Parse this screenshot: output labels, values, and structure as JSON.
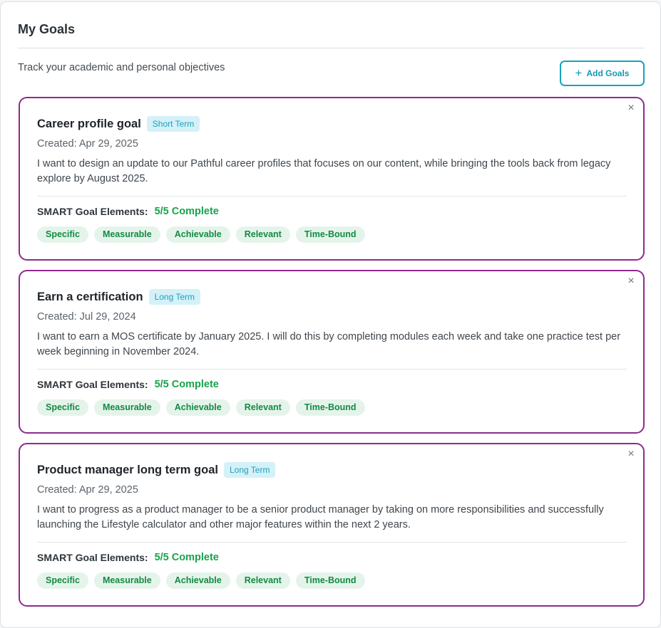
{
  "header": {
    "title": "My Goals",
    "subtitle": "Track your academic and personal objectives",
    "add_button": {
      "icon": "plus-icon",
      "label": "Add Goals"
    }
  },
  "smart_label": "SMART Goal Elements:",
  "goals": [
    {
      "title": "Career profile goal",
      "term": "Short Term",
      "created": "Created: Apr 29, 2025",
      "description": "I want to design an update to our Pathful career profiles that focuses on our content, while bringing the tools back from legacy explore by August 2025.",
      "smart_status": "5/5 Complete",
      "elements": [
        "Specific",
        "Measurable",
        "Achievable",
        "Relevant",
        "Time-Bound"
      ]
    },
    {
      "title": "Earn a certification",
      "term": "Long Term",
      "created": "Created: Jul 29, 2024",
      "description": "I want to earn a MOS certificate by January 2025. I will do this by completing modules each week and take one practice test per week beginning in November 2024.",
      "smart_status": "5/5 Complete",
      "elements": [
        "Specific",
        "Measurable",
        "Achievable",
        "Relevant",
        "Time-Bound"
      ]
    },
    {
      "title": "Product manager long term goal",
      "term": "Long Term",
      "created": "Created: Apr 29, 2025",
      "description": "I want to progress as a product manager to be a senior product manager by taking on more responsibilities and successfully launching the Lifestyle calculator and other major features within the next 2 years.",
      "smart_status": "5/5 Complete",
      "elements": [
        "Specific",
        "Measurable",
        "Achievable",
        "Relevant",
        "Time-Bound"
      ]
    }
  ],
  "colors": {
    "card_border": "#8e2a8e",
    "accent": "#16a2bf",
    "complete": "#16a34a"
  }
}
